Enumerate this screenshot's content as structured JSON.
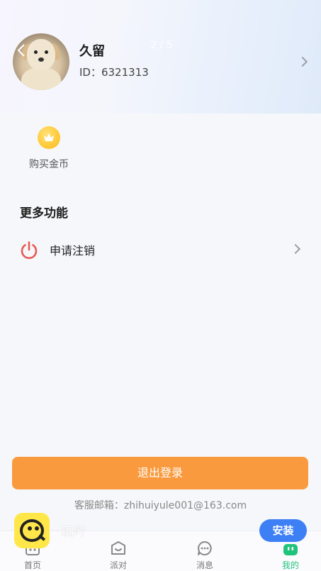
{
  "header": {
    "page_indicator": "2 / 5"
  },
  "profile": {
    "username": "久留",
    "user_id": "ID：6321313"
  },
  "quick_actions": [
    {
      "label": "购买金币",
      "icon": "crown-icon"
    }
  ],
  "more_section": {
    "title": "更多功能",
    "items": [
      {
        "label": "申请注销",
        "icon": "power-icon"
      }
    ]
  },
  "logout": {
    "label": "退出登录"
  },
  "contact": {
    "text": "客服邮箱：zhihuiyule001@163.com"
  },
  "tabbar": {
    "items": [
      {
        "label": "首页",
        "icon": "home-icon"
      },
      {
        "label": "派对",
        "icon": "party-icon"
      },
      {
        "label": "消息",
        "icon": "message-icon"
      },
      {
        "label": "我的",
        "icon": "profile-icon",
        "active": true
      }
    ]
  },
  "promo_banner": {
    "app_name": "玩吖",
    "install_label": "安装"
  },
  "colors": {
    "accent_orange": "#fa9a3e",
    "active_green": "#20c37a",
    "install_blue": "#3d7ff5",
    "power_red": "#e85a55",
    "coin_gold": "#ffc52e"
  }
}
